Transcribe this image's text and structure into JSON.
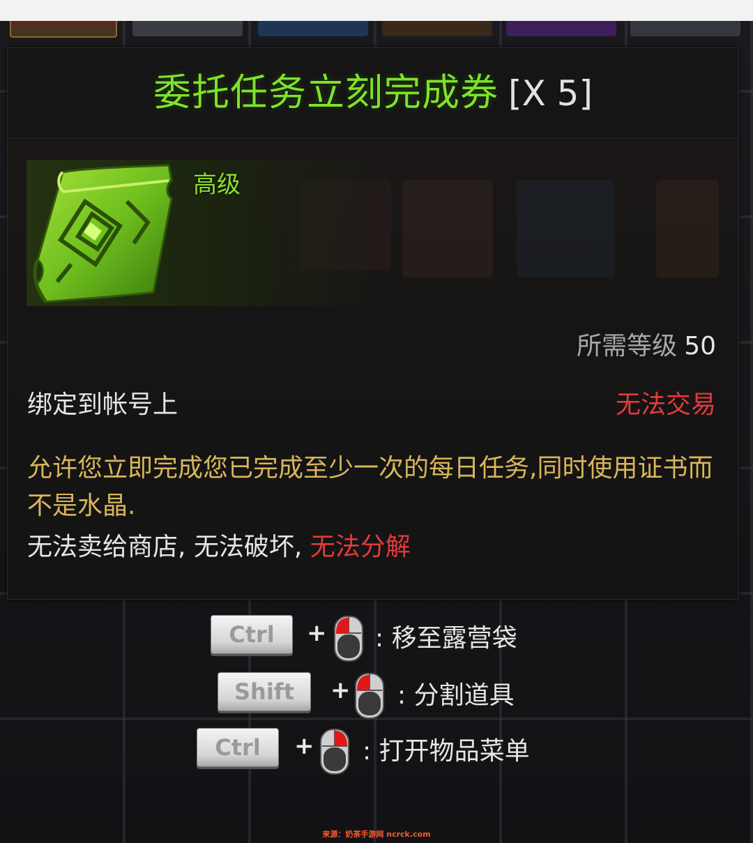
{
  "tooltip": {
    "title": "委托任务立刻完成券",
    "count": "[X 5]",
    "grade": "高级",
    "required_level_label": "所需等级",
    "required_level_value": "50",
    "bind_text": "绑定到帐号上",
    "trade_status": "无法交易",
    "description": "允许您立即完成您已完成至少一次的每日任务,同时使用证书而不是水晶.",
    "restrictions_prefix": "无法卖给商店, 无法破坏, ",
    "restriction_red": "无法分解"
  },
  "hotkeys": [
    {
      "key": "Ctrl",
      "plus": "+",
      "mouse_button": "left",
      "label": ": 移至露营袋"
    },
    {
      "key": "Shift",
      "plus": "+",
      "mouse_button": "left",
      "label": ": 分割道具"
    },
    {
      "key": "Ctrl",
      "plus": "+",
      "mouse_button": "right",
      "label": ": 打开物品菜单"
    }
  ],
  "source": "来源：奶茶手游网 ncrck.com",
  "colors": {
    "title_green": "#7ee12c",
    "grade_green": "#8ae02a",
    "description_gold": "#d9b65a",
    "warning_red": "#e23b3b",
    "mouse_click_red": "#e01818"
  },
  "icons": {
    "item": "green-scroll-icon",
    "mouse": "mouse-icon"
  }
}
